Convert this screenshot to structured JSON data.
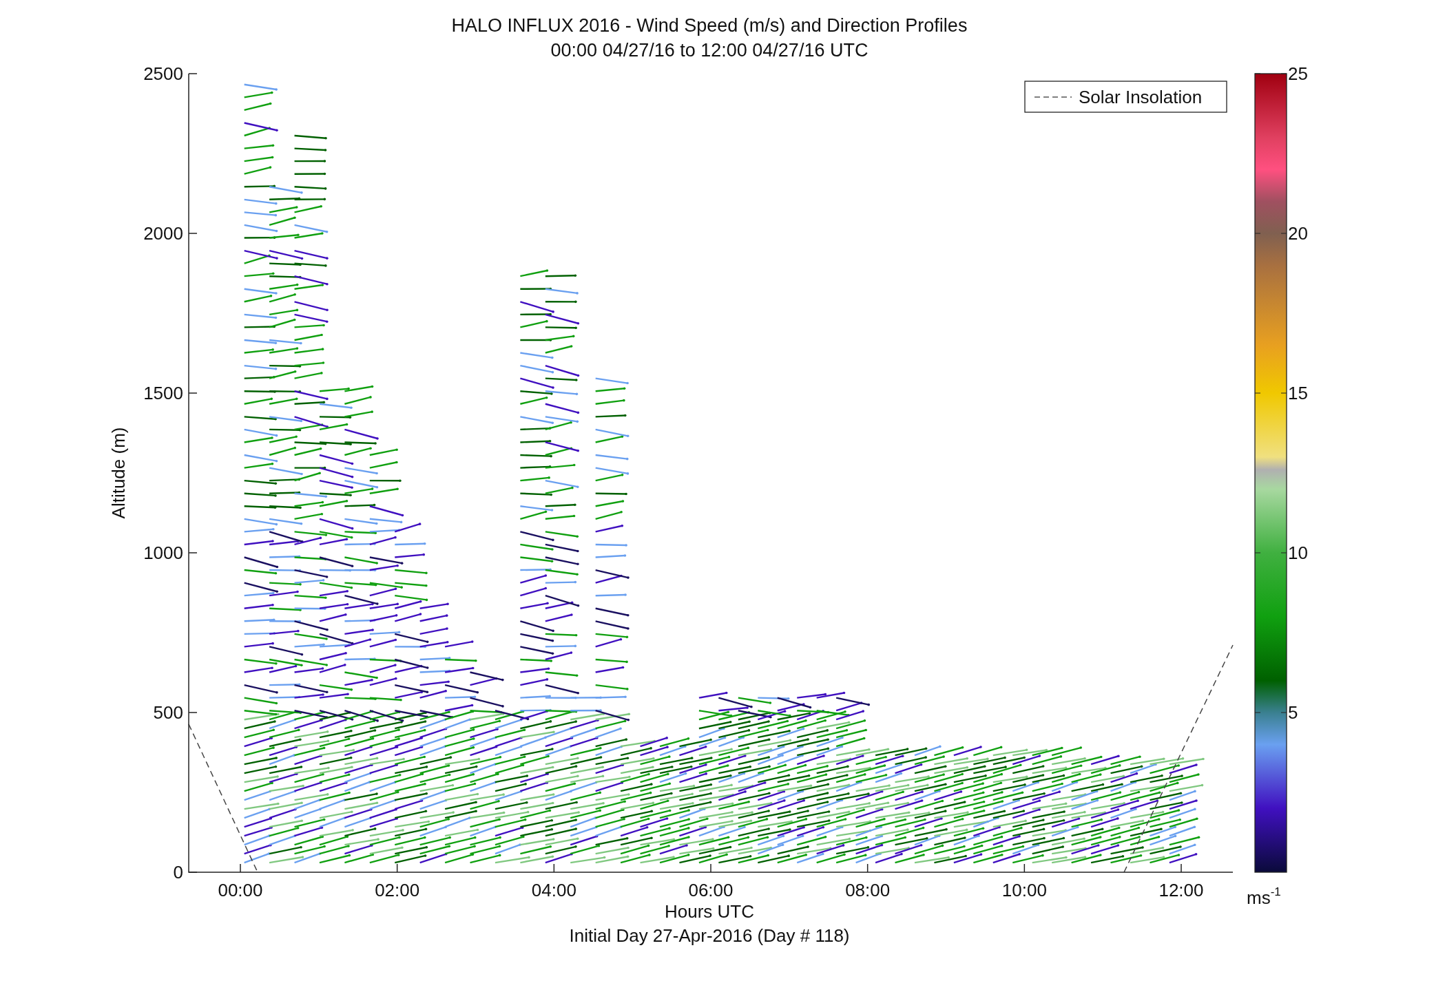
{
  "title": [
    "HALO INFLUX 2016 - Wind Speed (m/s) and Direction Profiles",
    "00:00 04/27/16 to 12:00 04/27/16  UTC"
  ],
  "chart": {
    "ylabel": "Altitude (m)",
    "xlabel": "Hours UTC",
    "subtitle": "Initial Day 27-Apr-2016 (Day # 118)",
    "xticks": [
      "00:00",
      "02:00",
      "04:00",
      "06:00",
      "08:00",
      "10:00",
      "12:00"
    ],
    "yticks": [
      "2500",
      "2000",
      "1500",
      "1000",
      "500",
      "0"
    ],
    "legend": {
      "label": "Solar Insolation"
    }
  },
  "colorbar": {
    "ticks": [
      "25",
      "20",
      "15",
      "10",
      "5"
    ],
    "unit": {
      "base": "ms",
      "exponent": "-1"
    }
  }
}
